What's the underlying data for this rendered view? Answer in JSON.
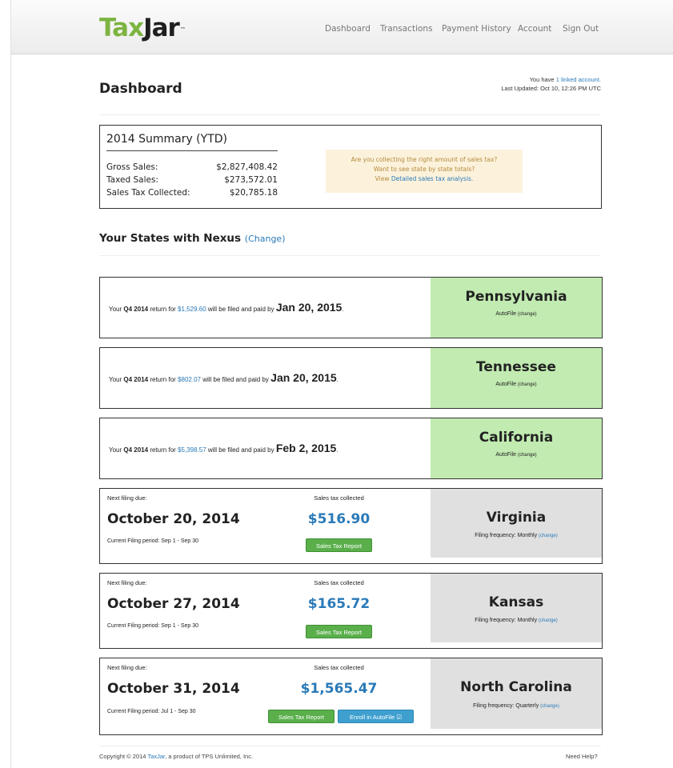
{
  "logo": {
    "tax": "Tax",
    "jar": "Jar",
    "tm": "™"
  },
  "nav": [
    {
      "label": "Dashboard"
    },
    {
      "label": "Transactions"
    },
    {
      "label": "Payment History"
    },
    {
      "label": "Account"
    },
    {
      "label": "Sign Out"
    }
  ],
  "page_title": "Dashboard",
  "account": {
    "prefix": "You have",
    "link": "1 linked account.",
    "last_updated": "Last Updated: Oct 10, 12:26 PM UTC"
  },
  "summary": {
    "title": "2014 Summary (YTD)",
    "rows": [
      {
        "label": "Gross Sales:",
        "value": "$2,827,408.42"
      },
      {
        "label": "Taxed Sales:",
        "value": "$273,572.01"
      },
      {
        "label": "Sales Tax Collected:",
        "value": "$20,785.18"
      }
    ],
    "callout": {
      "line1": "Are you collecting the right amount of sales tax?",
      "line2": "Want to see state by state totals?",
      "line3_prefix": "View",
      "line3_link": "Detailed sales tax analysis."
    }
  },
  "nexus": {
    "title": "Your States with Nexus",
    "change_link": "(Change)"
  },
  "autofile_states": [
    {
      "state": "Pennsylvania",
      "prefix": "Your",
      "quarter": "Q4 2014",
      "mid": "return for",
      "amount": "$1,529.60",
      "suffix": "will be filed and paid by",
      "due": "Jan 20, 2015",
      "end": ".",
      "sub": "AutoFile",
      "sub_link": "(change)"
    },
    {
      "state": "Tennessee",
      "prefix": "Your",
      "quarter": "Q4 2014",
      "mid": "return for",
      "amount": "$802.07",
      "suffix": "will be filed and paid by",
      "due": "Jan 20, 2015",
      "end": ".",
      "sub": "AutoFile",
      "sub_link": "(change)"
    },
    {
      "state": "California",
      "prefix": "Your",
      "quarter": "Q4 2014",
      "mid": "return for",
      "amount": "$5,398.57",
      "suffix": "will be filed and paid by",
      "due": "Feb 2, 2015",
      "end": ".",
      "sub": "AutoFile",
      "sub_link": "(change)"
    }
  ],
  "filing_states": [
    {
      "state": "Virginia",
      "next_label": "Next filing due:",
      "date": "October 20, 2014",
      "period": "Current Filing period: Sep 1 - Sep 30",
      "collected_label": "Sales tax collected",
      "amount": "$516.90",
      "report_btn": "Sales Tax Report",
      "freq": "Filing frequency: Monthly",
      "freq_link": "(change)"
    },
    {
      "state": "Kansas",
      "next_label": "Next filing due:",
      "date": "October 27, 2014",
      "period": "Current Filing period: Sep 1 - Sep 30",
      "collected_label": "Sales tax collected",
      "amount": "$165.72",
      "report_btn": "Sales Tax Report",
      "freq": "Filing frequency: Monthly",
      "freq_link": "(change)"
    },
    {
      "state": "North Carolina",
      "next_label": "Next filing due:",
      "date": "October 31, 2014",
      "period": "Current Filing period: Jul 1 - Sep 30",
      "collected_label": "Sales tax collected",
      "amount": "$1,565.47",
      "report_btn": "Sales Tax Report",
      "enroll_btn": "Enroll in AutoFile ☑",
      "freq": "Filing frequency: Quarterly",
      "freq_link": "(change)"
    }
  ],
  "footer": {
    "copyright_prefix": "Copyright © 2014",
    "brand_link": "TaxJar",
    "copyright_suffix": ", a product of TPS Unlimited, Inc.",
    "help": "Need Help?"
  },
  "colors": {
    "brand_green": "#7cb43f",
    "link_blue": "#2a7ab8",
    "autofile_green": "#c1ebb1",
    "manual_grey": "#e0e0e0",
    "button_green": "#5aaf4b",
    "button_blue": "#3fa0cf",
    "callout_bg": "#fcf2dc"
  }
}
